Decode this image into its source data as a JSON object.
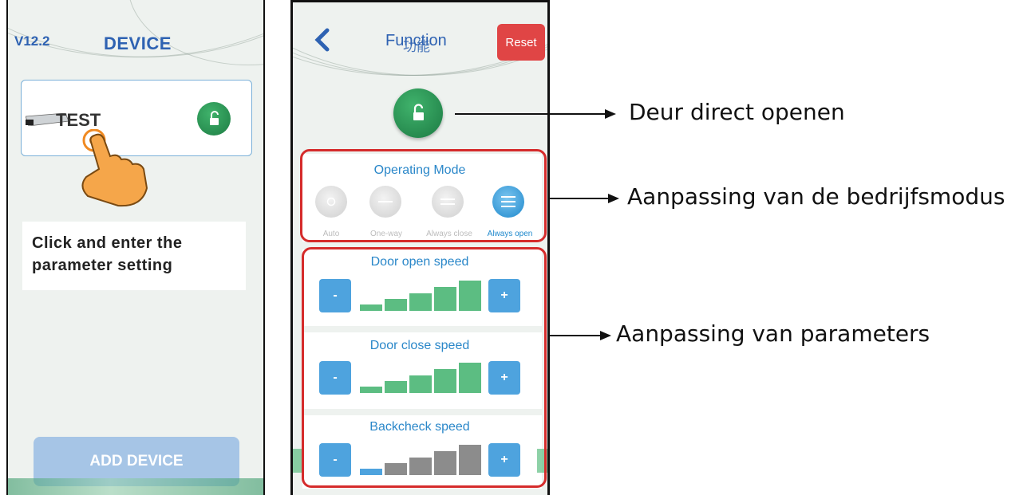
{
  "screen1": {
    "version": "V12.2",
    "title": "DEVICE",
    "device_name": "TEST",
    "instruction_line1": "Click and enter the",
    "instruction_line2": "parameter setting",
    "add_button": "ADD DEVICE"
  },
  "screen2": {
    "back_icon": "chevron-left-icon",
    "title": "Function",
    "title_overlay": "功能",
    "reset_button": "Reset",
    "operating_mode": {
      "title": "Operating Mode",
      "modes": [
        {
          "label": "Auto",
          "active": false,
          "icon": "circle-icon"
        },
        {
          "label": "One-way",
          "active": false,
          "icon": "single-line-icon"
        },
        {
          "label": "Always close",
          "active": false,
          "icon": "double-line-icon"
        },
        {
          "label": "Always open",
          "active": true,
          "icon": "triple-line-icon"
        }
      ]
    },
    "speeds": [
      {
        "title": "Door open speed",
        "minus": "-",
        "plus": "+",
        "level": 5,
        "max": 5
      },
      {
        "title": "Door close speed",
        "minus": "-",
        "plus": "+",
        "level": 5,
        "max": 5
      },
      {
        "title": "Backcheck speed",
        "minus": "-",
        "plus": "+",
        "level": 1,
        "max": 5
      }
    ]
  },
  "annotations": {
    "open_door": "Deur direct openen",
    "mode_adjust": "Aanpassing van de bedrijfsmodus",
    "param_adjust": "Aanpassing van parameters"
  },
  "colors": {
    "accent_blue": "#2e62b2",
    "green": "#5cbd82",
    "reset_red": "#e04545",
    "highlight_red": "#d52b2b"
  }
}
